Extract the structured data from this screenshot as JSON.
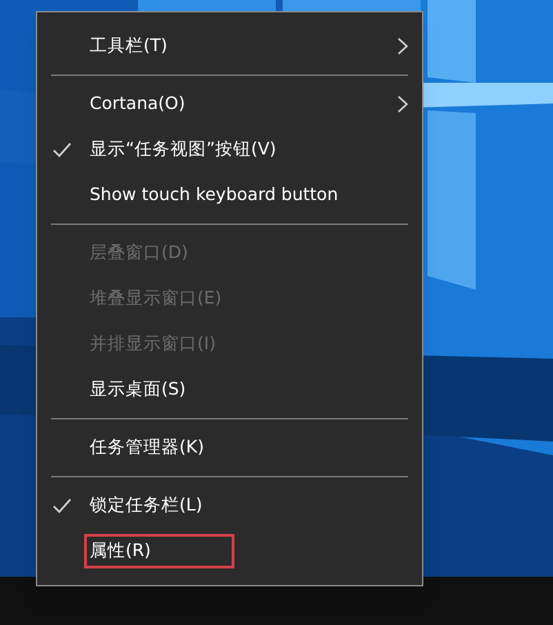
{
  "context_menu": {
    "items": [
      {
        "kind": "item",
        "label": "工具栏(T)",
        "submenu": true,
        "checked": false,
        "disabled": false,
        "highlighted": false
      },
      {
        "kind": "separator"
      },
      {
        "kind": "item",
        "label": "Cortana(O)",
        "submenu": true,
        "checked": false,
        "disabled": false,
        "highlighted": false
      },
      {
        "kind": "item",
        "label": "显示“任务视图”按钮(V)",
        "submenu": false,
        "checked": true,
        "disabled": false,
        "highlighted": false
      },
      {
        "kind": "item",
        "label": "Show touch keyboard button",
        "submenu": false,
        "checked": false,
        "disabled": false,
        "highlighted": false
      },
      {
        "kind": "separator"
      },
      {
        "kind": "item",
        "label": "层叠窗口(D)",
        "submenu": false,
        "checked": false,
        "disabled": true,
        "highlighted": false
      },
      {
        "kind": "item",
        "label": "堆叠显示窗口(E)",
        "submenu": false,
        "checked": false,
        "disabled": true,
        "highlighted": false
      },
      {
        "kind": "item",
        "label": "并排显示窗口(I)",
        "submenu": false,
        "checked": false,
        "disabled": true,
        "highlighted": false
      },
      {
        "kind": "item",
        "label": "显示桌面(S)",
        "submenu": false,
        "checked": false,
        "disabled": false,
        "highlighted": false
      },
      {
        "kind": "separator"
      },
      {
        "kind": "item",
        "label": "任务管理器(K)",
        "submenu": false,
        "checked": false,
        "disabled": false,
        "highlighted": false
      },
      {
        "kind": "separator"
      },
      {
        "kind": "item",
        "label": "锁定任务栏(L)",
        "submenu": false,
        "checked": true,
        "disabled": false,
        "highlighted": false
      },
      {
        "kind": "item",
        "label": "属性(R)",
        "submenu": false,
        "checked": false,
        "disabled": false,
        "highlighted": true
      }
    ]
  }
}
